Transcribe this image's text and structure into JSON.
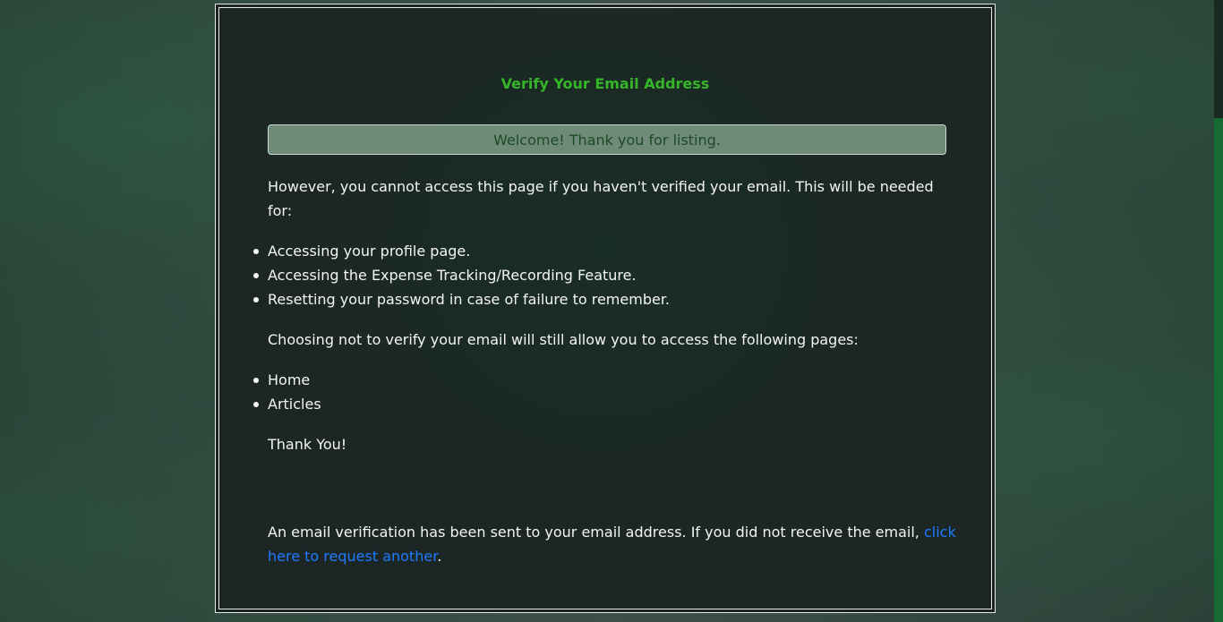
{
  "card": {
    "title": "Verify Your Email Address",
    "alert": "Welcome! Thank you for listing.",
    "intro": "However, you cannot access this page if you haven't verified your email. This will be needed for:",
    "required_for": [
      "Accessing your profile page.",
      "Accessing the Expense Tracking/Recording Feature.",
      "Resetting your password in case of failure to remember."
    ],
    "optional_intro": "Choosing not to verify your email will still allow you to access the following pages:",
    "allowed_pages": [
      "Home",
      "Articles"
    ],
    "thanks": "Thank You!",
    "sent_notice": "An email verification has been sent to your email address. If you did not receive the email,",
    "resend_link": "click here to request another",
    "resend_suffix": "."
  },
  "colors": {
    "title": "#36b52a",
    "alert_bg": "#6f8a78",
    "alert_text": "#1c4a25",
    "link": "#1e7bff",
    "card_bg": "#1c2624"
  }
}
